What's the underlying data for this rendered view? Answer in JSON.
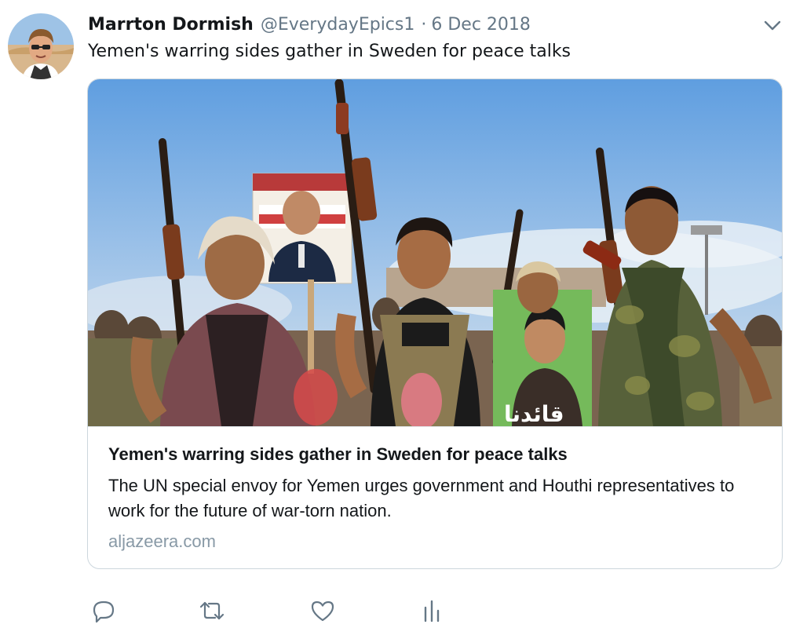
{
  "tweet": {
    "author": {
      "display_name": "Marrton Dormish",
      "handle": "@EverydayEpics1",
      "avatar_icon": "user-avatar-photo"
    },
    "separator": "·",
    "date": "6 Dec 2018",
    "text": "Yemen's warring sides gather in Sweden for peace talks",
    "menu_icon": "chevron-down-icon"
  },
  "card": {
    "image_icon": "news-photo",
    "image_text": "قائدنا",
    "title": "Yemen's warring sides gather in Sweden for peace talks",
    "description": "The UN special envoy for Yemen urges government and Houthi representatives to work for the future of war-torn nation.",
    "domain": "aljazeera.com"
  },
  "actions": [
    {
      "name": "reply",
      "icon": "reply-icon"
    },
    {
      "name": "retweet",
      "icon": "retweet-icon"
    },
    {
      "name": "like",
      "icon": "heart-icon"
    },
    {
      "name": "analytics",
      "icon": "analytics-icon"
    }
  ],
  "colors": {
    "text_primary": "#14171a",
    "text_secondary": "#657786",
    "domain_gray": "#8899a6",
    "border": "#ccd6dd",
    "sky": "#7fb2e5"
  }
}
